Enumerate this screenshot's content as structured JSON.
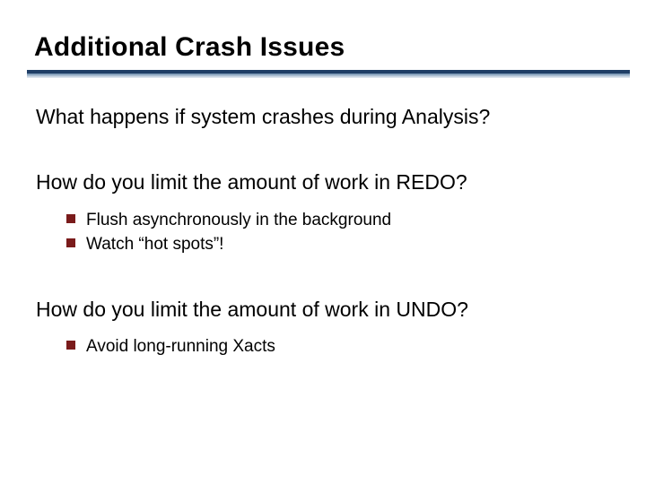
{
  "title": "Additional Crash Issues",
  "questions": {
    "q1": "What happens if system crashes during Analysis?",
    "q2": "How do you limit the amount of work in REDO?",
    "q3": "How do you limit the amount of work in UNDO?"
  },
  "bullets": {
    "redo": [
      "Flush asynchronously in the background",
      "Watch “hot spots”!"
    ],
    "undo": [
      "Avoid long-running Xacts"
    ]
  },
  "colors": {
    "rule_dark": "#1f3e66",
    "rule_light": "#6b8bab",
    "bullet_square": "#7a1b1b"
  }
}
